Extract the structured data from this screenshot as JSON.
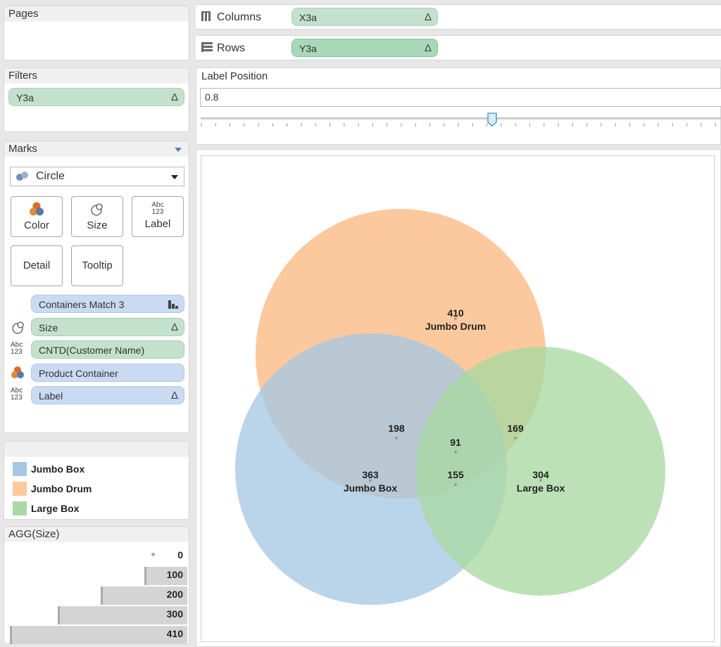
{
  "pages": {
    "title": "Pages"
  },
  "filters": {
    "title": "Filters",
    "items": [
      {
        "label": "Y3a",
        "icon": "delta-icon"
      }
    ]
  },
  "marks": {
    "title": "Marks",
    "mark_type": "Circle",
    "buttons": {
      "color": "Color",
      "size": "Size",
      "label": "Label",
      "detail": "Detail",
      "tooltip": "Tooltip"
    },
    "label_icon_text": "Abc\n123",
    "fields": [
      {
        "label": "Containers Match 3",
        "kind": "detail",
        "icon": "sort-bars-icon"
      },
      {
        "label": "Size",
        "kind": "size",
        "icon": "delta-icon"
      },
      {
        "label": "CNTD(Customer Name)",
        "kind": "label"
      },
      {
        "label": "Product Container",
        "kind": "color"
      },
      {
        "label": "Label",
        "kind": "label",
        "icon": "delta-icon"
      }
    ]
  },
  "color_legend": {
    "items": [
      {
        "label": "Jumbo Box",
        "color": "#a6c8e3"
      },
      {
        "label": "Jumbo Drum",
        "color": "#fbc99d"
      },
      {
        "label": "Large Box",
        "color": "#a9d8a3"
      }
    ]
  },
  "size_legend": {
    "title": "AGG(Size)",
    "items": [
      "0",
      "100",
      "200",
      "300",
      "410"
    ],
    "values": [
      0,
      100,
      200,
      300,
      410
    ],
    "max": 410
  },
  "shelves": {
    "columns": {
      "label": "Columns",
      "pill": "X3a"
    },
    "rows": {
      "label": "Rows",
      "pill": "Y3a"
    }
  },
  "parameter": {
    "title": "Label Position",
    "value": "0.8",
    "slider_fraction": 0.56,
    "tick_count": 37
  },
  "delta_glyph": "Δ",
  "chart_data": {
    "type": "venn",
    "sets": [
      {
        "name": "Jumbo Drum",
        "value": 410,
        "color": "#fbc99d"
      },
      {
        "name": "Jumbo Box",
        "value": 363,
        "color": "#a6c8e3"
      },
      {
        "name": "Large Box",
        "value": 304,
        "color": "#a9d8a3"
      }
    ],
    "intersections": [
      {
        "sets": [
          "Jumbo Box",
          "Jumbo Drum"
        ],
        "value": 198
      },
      {
        "sets": [
          "Jumbo Drum",
          "Large Box"
        ],
        "value": 169
      },
      {
        "sets": [
          "Jumbo Box",
          "Jumbo Drum",
          "Large Box"
        ],
        "value": 91
      },
      {
        "sets": [
          "Jumbo Box",
          "Large Box"
        ],
        "value": 155
      }
    ]
  }
}
